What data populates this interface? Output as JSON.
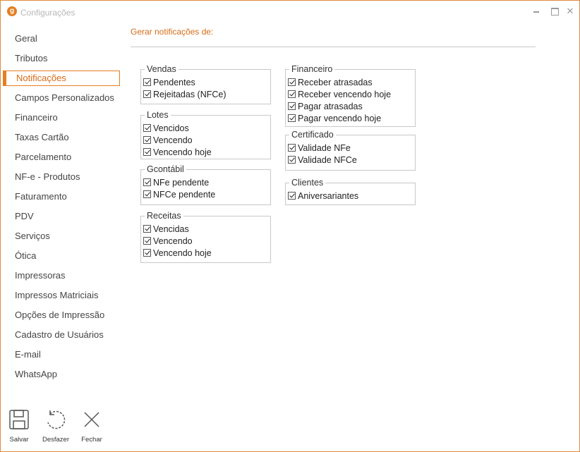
{
  "window": {
    "title": "Configurações",
    "app_icon_letter": "g",
    "close_glyph": "✕"
  },
  "sidebar": {
    "items": [
      {
        "label": "Geral"
      },
      {
        "label": "Tributos"
      },
      {
        "label": "Notificações",
        "active": true
      },
      {
        "label": "Campos Personalizados"
      },
      {
        "label": "Financeiro"
      },
      {
        "label": "Taxas Cartão"
      },
      {
        "label": "Parcelamento"
      },
      {
        "label": "NF-e - Produtos"
      },
      {
        "label": "Faturamento"
      },
      {
        "label": "PDV"
      },
      {
        "label": "Serviços"
      },
      {
        "label": "Ótica"
      },
      {
        "label": "Impressoras"
      },
      {
        "label": "Impressos Matriciais"
      },
      {
        "label": "Opções de Impressão"
      },
      {
        "label": "Cadastro de Usuários"
      },
      {
        "label": "E-mail"
      },
      {
        "label": "WhatsApp"
      }
    ]
  },
  "content": {
    "title": "Gerar notificações de:"
  },
  "groups": {
    "vendas": {
      "title": "Vendas",
      "items": [
        {
          "label": "Pendentes",
          "checked": true
        },
        {
          "label": "Rejeitadas (NFCe)",
          "checked": true
        }
      ]
    },
    "lotes": {
      "title": "Lotes",
      "items": [
        {
          "label": "Vencidos",
          "checked": true
        },
        {
          "label": "Vencendo",
          "checked": true
        },
        {
          "label": "Vencendo hoje",
          "checked": true
        }
      ]
    },
    "gcontabil": {
      "title": "Gcontábil",
      "items": [
        {
          "label": "NFe pendente",
          "checked": true
        },
        {
          "label": "NFCe pendente",
          "checked": true
        }
      ]
    },
    "receitas": {
      "title": "Receitas",
      "items": [
        {
          "label": "Vencidas",
          "checked": true
        },
        {
          "label": "Vencendo",
          "checked": true
        },
        {
          "label": "Vencendo hoje",
          "checked": true
        }
      ]
    },
    "financeiro": {
      "title": "Financeiro",
      "items": [
        {
          "label": "Receber atrasadas",
          "checked": true
        },
        {
          "label": "Receber vencendo hoje",
          "checked": true
        },
        {
          "label": "Pagar atrasadas",
          "checked": true
        },
        {
          "label": "Pagar vencendo hoje",
          "checked": true
        }
      ]
    },
    "certificado": {
      "title": "Certificado",
      "items": [
        {
          "label": "Validade NFe",
          "checked": true
        },
        {
          "label": "Validade NFCe",
          "checked": true
        }
      ]
    },
    "clientes": {
      "title": "Clientes",
      "items": [
        {
          "label": "Aniversariantes",
          "checked": true
        }
      ]
    }
  },
  "toolbar": {
    "save_label": "Salvar",
    "undo_label": "Desfazer",
    "close_label": "Fechar"
  },
  "colors": {
    "accent": "#e67e22",
    "accent_text": "#d86b15",
    "border": "#c8c8c8"
  }
}
